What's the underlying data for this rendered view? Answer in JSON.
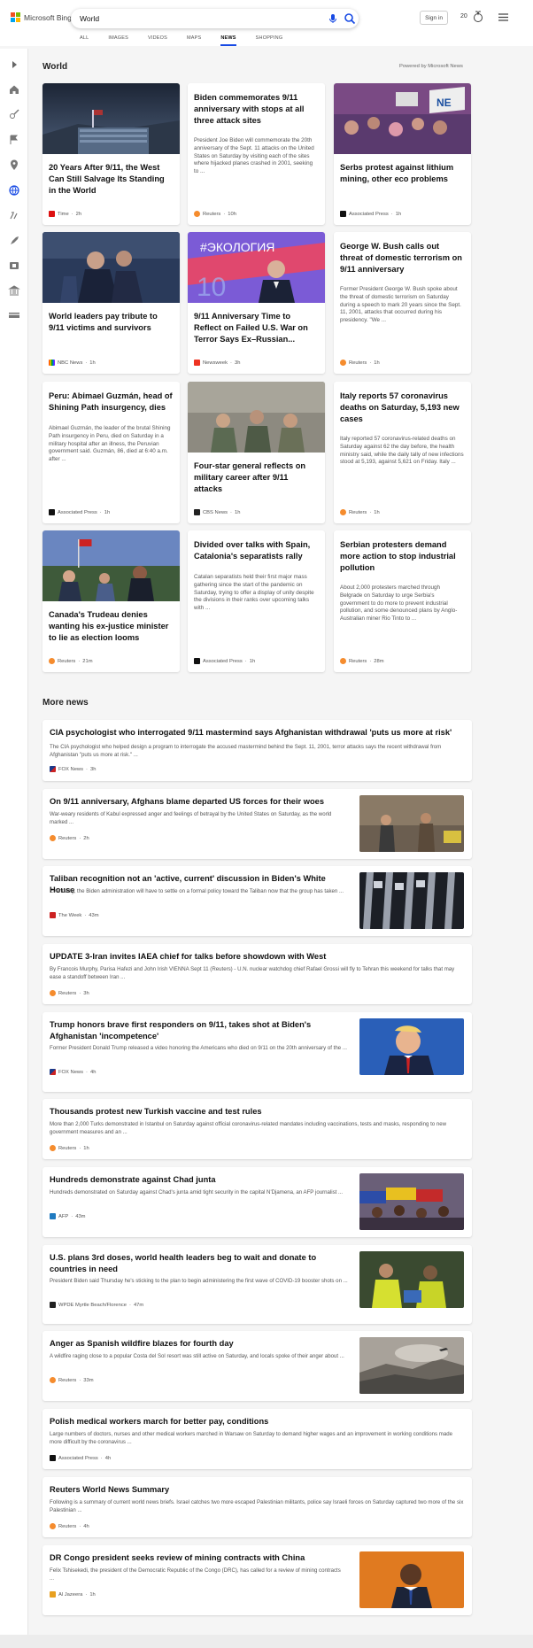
{
  "header": {
    "brand": "Microsoft Bing",
    "search_value": "World",
    "sign_in": "Sign in",
    "points": "20",
    "tabs": [
      "ALL",
      "IMAGES",
      "VIDEOS",
      "MAPS",
      "NEWS",
      "SHOPPING"
    ],
    "active_tab": "NEWS"
  },
  "colors": {
    "accent": "#174ae4",
    "brand_red": "#f25022",
    "brand_green": "#7fba00",
    "brand_blue": "#00a4ef",
    "brand_yellow": "#ffb900"
  },
  "sidebar": {
    "icons": [
      "chevron-right-icon",
      "home-icon",
      "sports-icon",
      "flag-icon",
      "location-pin-icon",
      "globe-icon",
      "science-icon",
      "rocket-icon",
      "entertainment-icon",
      "bank-icon",
      "money-icon"
    ]
  },
  "world": {
    "title": "World",
    "powered_by": "Powered by Microsoft News",
    "cards": [
      {
        "title": "20 Years After 9/11, the West Can Still Salvage Its Standing in the World",
        "summary": "",
        "source": "Time",
        "age": "2h"
      },
      {
        "title": "Biden commemorates 9/11 anniversary with stops at all three attack sites",
        "summary": "President Joe Biden will commemorate the 20th anniversary of the Sept. 11 attacks on the United States on Saturday by visiting each of the sites where hijacked planes crashed in 2001, seeking to ...",
        "source": "Reuters",
        "age": "10h"
      },
      {
        "title": "Serbs protest against lithium mining, other eco problems",
        "summary": "",
        "source": "Associated Press",
        "age": "1h"
      },
      {
        "title": "World leaders pay tribute to 9/11 victims and survivors",
        "summary": "",
        "source": "NBC News",
        "age": "1h"
      },
      {
        "title": "9/11 Anniversary Time to Reflect on Failed U.S. War on Terror Says Ex–Russian...",
        "summary": "",
        "source": "Newsweek",
        "age": "3h"
      },
      {
        "title": "George W. Bush calls out threat of domestic terrorism on 9/11 anniversary",
        "summary": "Former President George W. Bush spoke about the threat of domestic terrorism on Saturday during a speech to mark 20 years since the Sept. 11, 2001, attacks that occurred during his presidency. \"We ...",
        "source": "Reuters",
        "age": "1h"
      },
      {
        "title": "Peru: Abimael Guzmán, head of Shining Path insurgency, dies",
        "summary": "Abimael Guzmán, the leader of the brutal Shining Path insurgency in Peru, died on Saturday in a military hospital after an illness, the Peruvian government said. Guzmán, 86, died at 6:40 a.m. after ...",
        "source": "Associated Press",
        "age": "1h"
      },
      {
        "title": "Four-star general reflects on military career after 9/11 attacks",
        "summary": "",
        "source": "CBS News",
        "age": "1h"
      },
      {
        "title": "Italy reports 57 coronavirus deaths on Saturday, 5,193 new cases",
        "summary": "Italy reported 57 coronavirus-related deaths on Saturday against 62 the day before, the health ministry said, while the daily tally of new infections stood at 5,193, against 5,621 on Friday. Italy ...",
        "source": "Reuters",
        "age": "1h"
      },
      {
        "title": "Canada's Trudeau denies wanting his ex-justice minister to lie as election looms",
        "summary": "",
        "source": "Reuters",
        "age": "21m"
      },
      {
        "title": "Divided over talks with Spain, Catalonia's separatists rally",
        "summary": "Catalan separatists held their first major mass gathering since the start of the pandemic on Saturday, trying to offer a display of unity despite the divisions in their ranks over upcoming talks with ...",
        "source": "Associated Press",
        "age": "1h"
      },
      {
        "title": "Serbian protesters demand more action to stop industrial pollution",
        "summary": "About 2,000 protesters marched through Belgrade on Saturday to urge Serbia's government to do more to prevent industrial pollution, and some denounced plans by Anglo-Australian miner Rio Tinto to ...",
        "source": "Reuters",
        "age": "28m"
      }
    ],
    "image_texts": {
      "ekologiya": "#ЭКОЛОГИЯ",
      "ten": "10",
      "sign": "NE"
    }
  },
  "more_news": {
    "title": "More news",
    "items": [
      {
        "title": "CIA psychologist who interrogated 9/11 mastermind says Afghanistan withdrawal 'puts us more at risk'",
        "summary": "The CIA psychologist who helped design a program to interrogate the accused mastermind behind the Sept. 11, 2001, terror attacks says the recent withdrawal from Afghanistan \"puts us more at risk.\" ...",
        "source": "FOX News",
        "age": "3h"
      },
      {
        "title": "On 9/11 anniversary, Afghans blame departed US forces for their woes",
        "summary": "War-weary residents of Kabul expressed anger and feelings of betrayal by the United States on Saturday, as the world marked ...",
        "source": "Reuters",
        "age": "2h"
      },
      {
        "title": "Taliban recognition not an 'active, current' discussion in Biden's White House",
        "summary": "Eventually, the Biden administration will have to settle on a formal policy toward the Taliban now that the group has taken ...",
        "source": "The Week",
        "age": "43m"
      },
      {
        "title": "UPDATE 3-Iran invites IAEA chief for talks before showdown with West",
        "summary": "By Francois Murphy, Parisa Hafezi and John Irish VIENNA Sept 11 (Reuters) - U.N. nuclear watchdog chief Rafael Grossi will fly to Tehran this weekend for talks that may ease a standoff between Iran ...",
        "source": "Reuters",
        "age": "3h"
      },
      {
        "title": "Trump honors brave first responders on 9/11, takes shot at Biden's Afghanistan 'incompetence'",
        "summary": "Former President Donald Trump released a video honoring the Americans who died on 9/11 on the 20th anniversary of the ...",
        "source": "FOX News",
        "age": "4h"
      },
      {
        "title": "Thousands protest new Turkish vaccine and test rules",
        "summary": "More than 2,000 Turks demonstrated in Istanbul on Saturday against official coronavirus-related mandates including vaccinations, tests and masks, responding to new government measures and an ...",
        "source": "Reuters",
        "age": "1h"
      },
      {
        "title": "Hundreds demonstrate against Chad junta",
        "summary": "Hundreds demonstrated on Saturday against Chad's junta amid tight security in the capital N'Djamena, an AFP journalist ...",
        "source": "AFP",
        "age": "43m"
      },
      {
        "title": "U.S. plans 3rd doses, world health leaders beg to wait and donate to countries in need",
        "summary": "President Biden said Thursday he's sticking to the plan to begin administering the first wave of COVID-19 booster shots on ...",
        "source": "WPDE Myrtle Beach/Florence",
        "age": "47m"
      },
      {
        "title": "Anger as Spanish wildfire blazes for fourth day",
        "summary": "A wildfire raging close to a popular Costa del Sol resort was still active on Saturday, and locals spoke of their anger about ...",
        "source": "Reuters",
        "age": "33m"
      },
      {
        "title": "Polish medical workers march for better pay, conditions",
        "summary": "Large numbers of doctors, nurses and other medical workers marched in Warsaw on Saturday to demand higher wages and an improvement in working conditions made more difficult by the coronavirus ...",
        "source": "Associated Press",
        "age": "4h"
      },
      {
        "title": "Reuters World News Summary",
        "summary": "Following is a summary of current world news briefs. Israel catches two more escaped Palestinian militants, police say Israeli forces on Saturday captured two more of the six Palestinian ...",
        "source": "Reuters",
        "age": "4h"
      },
      {
        "title": "DR Congo president seeks review of mining contracts with China",
        "summary": "Felix Tshisekedi, the president of the Democratic Republic of the Congo (DRC), has called for a review of mining contracts ...",
        "source": "Al Jazeera",
        "age": "1h"
      }
    ]
  }
}
